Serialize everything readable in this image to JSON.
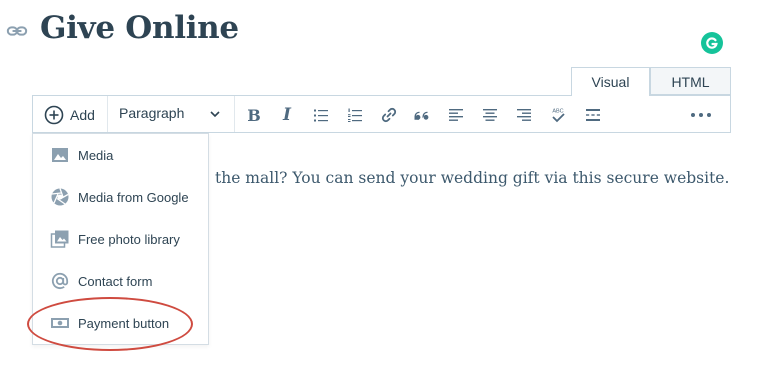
{
  "page": {
    "title": "Give Online"
  },
  "tabs": [
    {
      "label": "Visual"
    },
    {
      "label": "HTML"
    }
  ],
  "toolbar": {
    "add_label": "Add",
    "format_label": "Paragraph",
    "bold_glyph": "B",
    "italic_glyph": "I",
    "spellcheck_glyph": "ABC"
  },
  "add_menu": {
    "items": [
      {
        "label": "Media",
        "icon": "image-icon"
      },
      {
        "label": "Media from Google",
        "icon": "aperture-icon"
      },
      {
        "label": "Free photo library",
        "icon": "photo-library-icon"
      },
      {
        "label": "Contact form",
        "icon": "at-icon"
      },
      {
        "label": "Payment button",
        "icon": "money-icon"
      }
    ]
  },
  "content": {
    "text": "the mall? You can send your wedding gift via this secure website."
  },
  "colors": {
    "annotation": "#cf4b40",
    "grammarly": "#15c39a",
    "icon": "#4f6a80"
  }
}
